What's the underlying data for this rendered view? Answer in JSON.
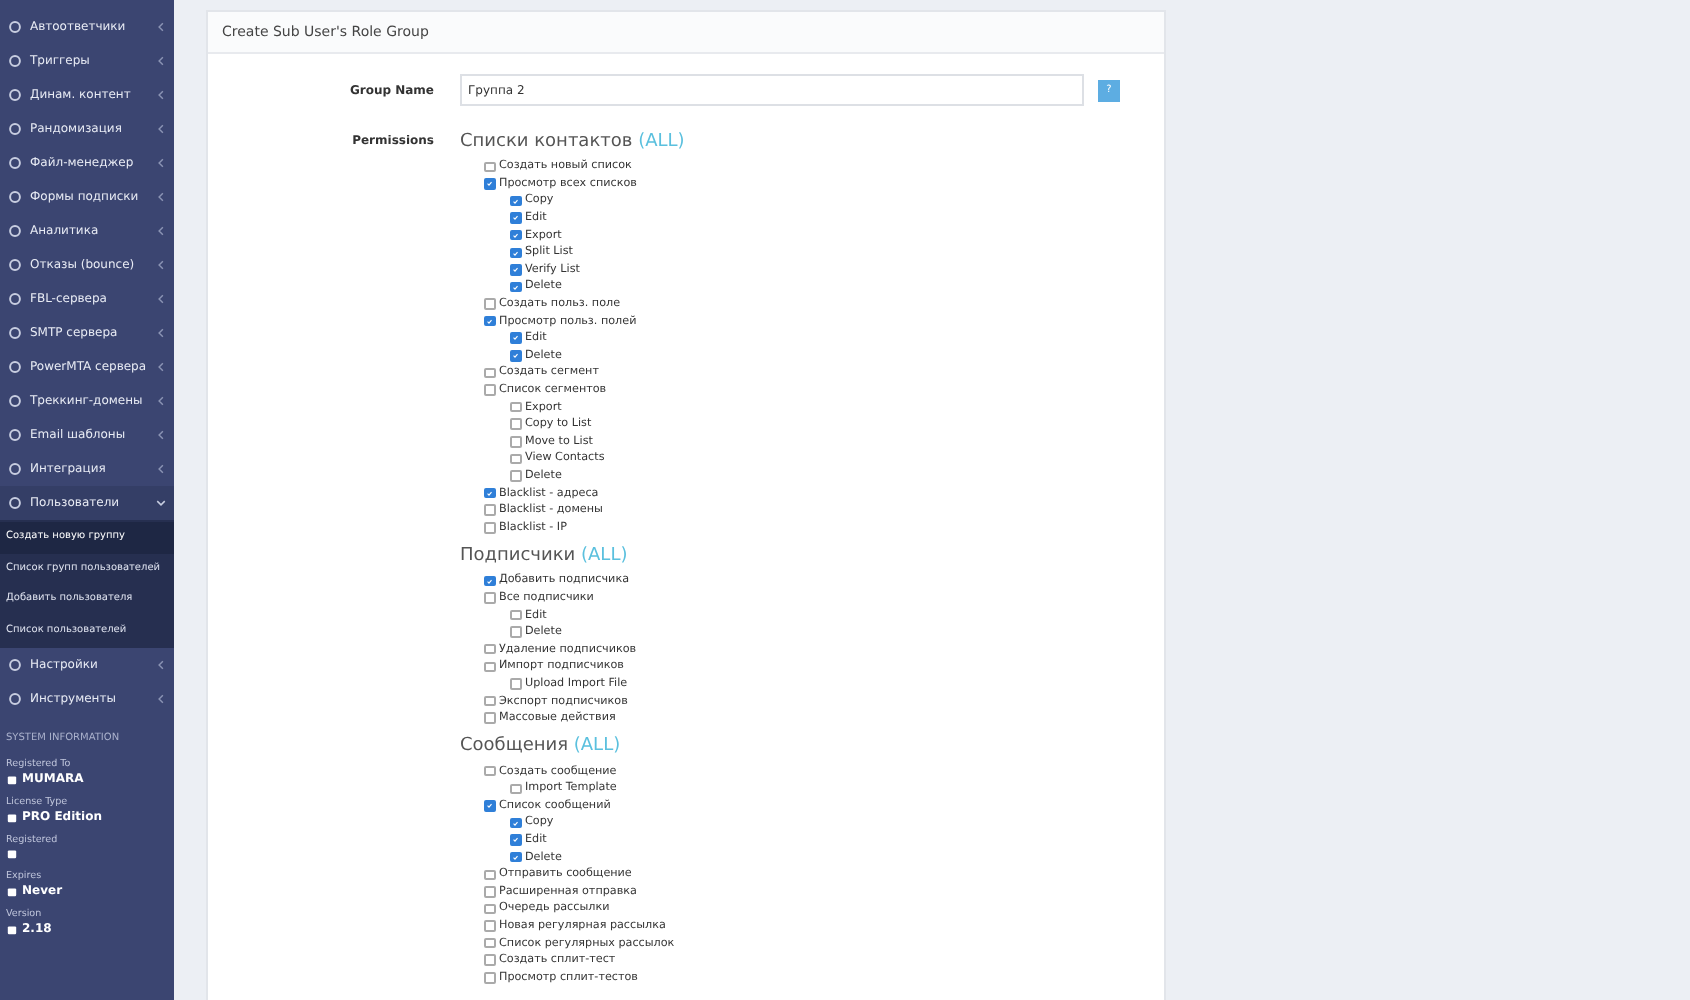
{
  "sidebar": {
    "items": [
      {
        "label": "Автоответчики",
        "expanded": false
      },
      {
        "label": "Триггеры",
        "expanded": false
      },
      {
        "label": "Динам. контент",
        "expanded": false
      },
      {
        "label": "Рандомизация",
        "expanded": false
      },
      {
        "label": "Файл-менеджер",
        "expanded": false
      },
      {
        "label": "Формы подписки",
        "expanded": false
      },
      {
        "label": "Аналитика",
        "expanded": false
      },
      {
        "label": "Отказы (bounce)",
        "expanded": false
      },
      {
        "label": "FBL-сервера",
        "expanded": false
      },
      {
        "label": "SMTP сервера",
        "expanded": false
      },
      {
        "label": "PowerMTA сервера",
        "expanded": false
      },
      {
        "label": "Треккинг-домены",
        "expanded": false
      },
      {
        "label": "Email шаблоны",
        "expanded": false
      },
      {
        "label": "Интеграция",
        "expanded": false
      },
      {
        "label": "Пользователи",
        "expanded": true,
        "children": [
          {
            "label": "Создать новую группу",
            "selected": true
          },
          {
            "label": "Список групп пользователей",
            "selected": false
          },
          {
            "label": "Добавить пользователя",
            "selected": false
          },
          {
            "label": "Список пользователей",
            "selected": false
          }
        ]
      },
      {
        "label": "Настройки",
        "expanded": false
      },
      {
        "label": "Инструменты",
        "expanded": false
      }
    ]
  },
  "system_info": {
    "heading": "SYSTEM INFORMATION",
    "entries": [
      {
        "label": "Registered To",
        "value": "MUMARA"
      },
      {
        "label": "License Type",
        "value": "PRO Edition"
      },
      {
        "label": "Registered"
      },
      {
        "label": "Expires",
        "value": "Never"
      },
      {
        "label": "Version",
        "value": "2.18"
      }
    ]
  },
  "card": {
    "title": "Create Sub User's Role Group",
    "group_name": {
      "label": "Group Name",
      "value": "Группа 2",
      "help": "?"
    },
    "permissions": {
      "label": "Permissions",
      "sections": [
        {
          "title": "Списки контактов",
          "all": "(ALL)",
          "items": [
            {
              "label": "Создать новый список",
              "checked": false
            },
            {
              "label": "Просмотр всех списков",
              "checked": true,
              "children": [
                {
                  "label": "Copy",
                  "checked": true
                },
                {
                  "label": "Edit",
                  "checked": true
                },
                {
                  "label": "Export",
                  "checked": true
                },
                {
                  "label": "Split List",
                  "checked": true
                },
                {
                  "label": "Verify List",
                  "checked": true
                },
                {
                  "label": "Delete",
                  "checked": true
                }
              ]
            },
            {
              "label": "Создать польз. поле",
              "checked": false
            },
            {
              "label": "Просмотр польз. полей",
              "checked": true,
              "children": [
                {
                  "label": "Edit",
                  "checked": true
                },
                {
                  "label": "Delete",
                  "checked": true
                }
              ]
            },
            {
              "label": "Создать сегмент",
              "checked": false
            },
            {
              "label": "Список сегментов",
              "checked": false,
              "children": [
                {
                  "label": "Export",
                  "checked": false
                },
                {
                  "label": "Copy to List",
                  "checked": false
                },
                {
                  "label": "Move to List",
                  "checked": false
                },
                {
                  "label": "View Contacts",
                  "checked": false
                },
                {
                  "label": "Delete",
                  "checked": false
                }
              ]
            },
            {
              "label": "Blacklist - адреса",
              "checked": true
            },
            {
              "label": "Blacklist - домены",
              "checked": false
            },
            {
              "label": "Blacklist - IP",
              "checked": false
            }
          ]
        },
        {
          "title": "Подписчики",
          "all": "(ALL)",
          "items": [
            {
              "label": "Добавить подписчика",
              "checked": true
            },
            {
              "label": "Все подписчики",
              "checked": false,
              "children": [
                {
                  "label": "Edit",
                  "checked": false
                },
                {
                  "label": "Delete",
                  "checked": false
                }
              ]
            },
            {
              "label": "Удаление подписчиков",
              "checked": false
            },
            {
              "label": "Импорт подписчиков",
              "checked": false,
              "children": [
                {
                  "label": "Upload Import File",
                  "checked": false
                }
              ]
            },
            {
              "label": "Экспорт подписчиков",
              "checked": false
            },
            {
              "label": "Массовые действия",
              "checked": false
            }
          ]
        },
        {
          "title": "Сообщения",
          "all": "(ALL)",
          "items": [
            {
              "label": "Создать сообщение",
              "checked": false,
              "children": [
                {
                  "label": "Import Template",
                  "checked": false
                }
              ]
            },
            {
              "label": "Список сообщений",
              "checked": true,
              "children": [
                {
                  "label": "Copy",
                  "checked": true
                },
                {
                  "label": "Edit",
                  "checked": true
                },
                {
                  "label": "Delete",
                  "checked": true
                }
              ]
            },
            {
              "label": "Отправить сообщение",
              "checked": false
            },
            {
              "label": "Расширенная отправка",
              "checked": false
            },
            {
              "label": "Очередь рассылки",
              "checked": false
            },
            {
              "label": "Новая регулярная рассылка",
              "checked": false
            },
            {
              "label": "Список регулярных рассылок",
              "checked": false
            },
            {
              "label": "Создать сплит-тест",
              "checked": false
            },
            {
              "label": "Просмотр сплит-тестов",
              "checked": false
            }
          ]
        }
      ]
    }
  }
}
